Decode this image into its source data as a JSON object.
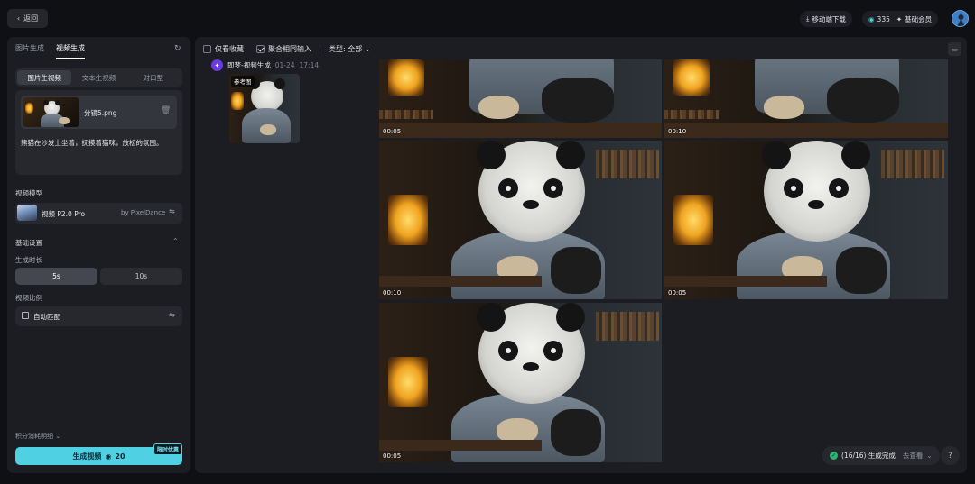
{
  "topbar": {
    "back_label": "返回",
    "download_label": "移动端下载",
    "credits": "335",
    "vip_label": "基础会员"
  },
  "sidebar": {
    "tabs": [
      "图片生成",
      "视频生成"
    ],
    "active_tab": "视频生成",
    "subtabs": [
      "图片生视频",
      "文本生视频",
      "对口型"
    ],
    "active_subtab": "图片生视频",
    "file_name": "分镜5.png",
    "prompt": "熊猫在沙发上坐着，抚摸着猫咪，放松的氛围。",
    "model_section": "视频模型",
    "model_name": "视频 P2.0 Pro",
    "model_by": "by PixelDance",
    "basic_settings": "基础设置",
    "duration_label": "生成时长",
    "durations": [
      "5s",
      "10s"
    ],
    "active_duration": "5s",
    "ratio_label": "视频比例",
    "ratio_value": "自动匹配",
    "credit_detail": "积分消耗明细",
    "generate_label": "生成视频",
    "generate_cost": "20",
    "promo_badge": "限时优惠"
  },
  "main": {
    "filter_favorites": "仅看收藏",
    "filter_aggregate": "聚合相同输入",
    "type_label": "类型: 全部",
    "sender": "即梦-视频生成",
    "date": "01-24",
    "time": "17:14",
    "ref_label": "参考图",
    "videos": [
      {
        "duration": "00:05"
      },
      {
        "duration": "00:10"
      },
      {
        "duration": "00:10"
      },
      {
        "duration": "00:05"
      },
      {
        "duration": "00:05"
      }
    ],
    "status": "(16/16) 生成完成",
    "view_label": "去查看",
    "help_label": "?"
  },
  "colors": {
    "accent": "#4fd1e3",
    "success": "#2bb673",
    "brand": "#6c3be0"
  }
}
